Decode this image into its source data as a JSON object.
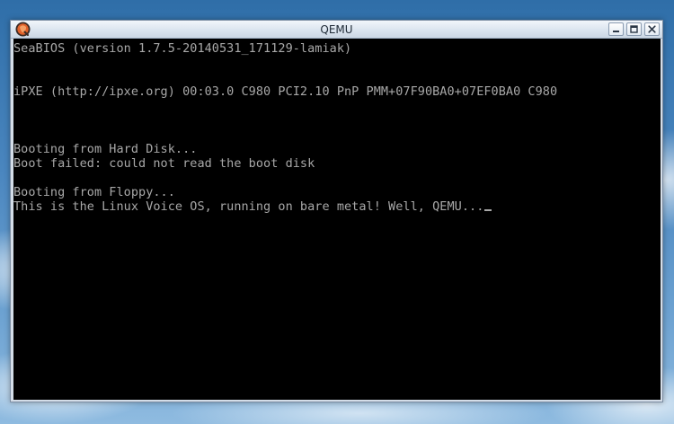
{
  "window": {
    "title": "QEMU",
    "icon": "qemu-app-icon",
    "controls": {
      "minimize_icon": "minimize-icon",
      "maximize_icon": "maximize-icon",
      "close_icon": "close-icon"
    }
  },
  "console": {
    "lines": [
      "SeaBIOS (version 1.7.5-20140531_171129-lamiak)",
      "",
      "",
      "iPXE (http://ipxe.org) 00:03.0 C980 PCI2.10 PnP PMM+07F90BA0+07EF0BA0 C980",
      "",
      "",
      "",
      "Booting from Hard Disk...",
      "Boot failed: could not read the boot disk",
      "",
      "Booting from Floppy...",
      "This is the Linux Voice OS, running on bare metal! Well, QEMU..."
    ],
    "text_color": "#a8a8a8",
    "background_color": "#000000"
  }
}
